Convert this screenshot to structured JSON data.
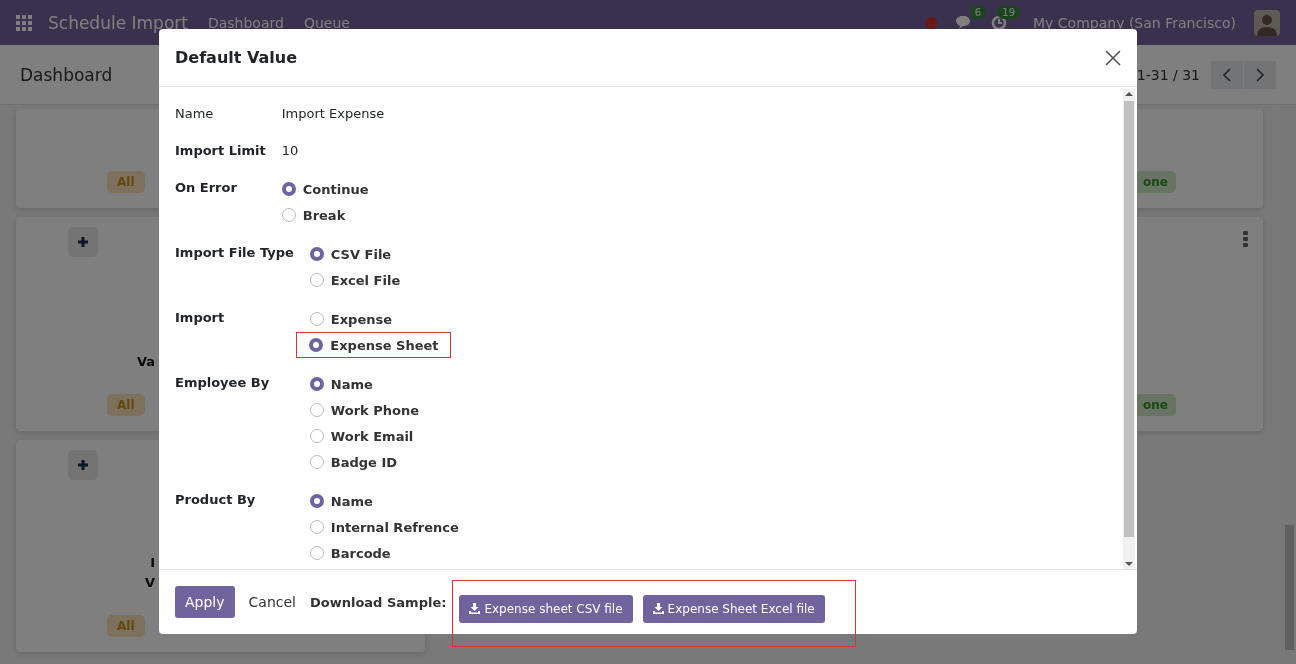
{
  "navbar": {
    "app_title": "Schedule Import",
    "menu": [
      {
        "label": "Dashboard"
      },
      {
        "label": "Queue"
      }
    ],
    "messages_count": "6",
    "activities_count": "19",
    "company": "My Company (San Francisco)"
  },
  "control_panel": {
    "title": "Dashboard",
    "pager": "1-31 / 31"
  },
  "cards": [
    {
      "left_badge": "All",
      "right_badge": "one"
    },
    {
      "title_lines": [
        "Va"
      ],
      "left_badge": "All",
      "right_badge": "one",
      "add": true,
      "kebab": true
    },
    {
      "title_lines": [
        "I",
        "V"
      ],
      "left_badge": "All",
      "add": true
    }
  ],
  "dialog": {
    "title": "Default Value",
    "groups": [
      {
        "fields": [
          {
            "kind": "text",
            "label": "Name",
            "value": "Import Expense",
            "bold_label": false
          },
          {
            "kind": "text",
            "label": "Import Limit",
            "value": "10",
            "bold_label": true
          },
          {
            "kind": "radio",
            "label": "On Error",
            "options": [
              {
                "label": "Continue",
                "selected": true,
                "highlighted": false
              },
              {
                "label": "Break",
                "selected": false,
                "highlighted": false
              }
            ]
          }
        ]
      },
      {
        "fields": [
          {
            "kind": "radio",
            "label": "Import File Type",
            "options": [
              {
                "label": "CSV File",
                "selected": true,
                "highlighted": false
              },
              {
                "label": "Excel File",
                "selected": false,
                "highlighted": false
              }
            ]
          },
          {
            "kind": "radio",
            "label": "Import",
            "options": [
              {
                "label": "Expense",
                "selected": false,
                "highlighted": false
              },
              {
                "label": "Expense Sheet",
                "selected": true,
                "highlighted": true
              }
            ]
          },
          {
            "kind": "radio",
            "label": "Employee By",
            "options": [
              {
                "label": "Name",
                "selected": true,
                "highlighted": false
              },
              {
                "label": "Work Phone",
                "selected": false,
                "highlighted": false
              },
              {
                "label": "Work Email",
                "selected": false,
                "highlighted": false
              },
              {
                "label": "Badge ID",
                "selected": false,
                "highlighted": false
              }
            ]
          },
          {
            "kind": "radio",
            "label": "Product By",
            "options": [
              {
                "label": "Name",
                "selected": true,
                "highlighted": false
              },
              {
                "label": "Internal Refrence",
                "selected": false,
                "highlighted": false
              },
              {
                "label": "Barcode",
                "selected": false,
                "highlighted": false
              }
            ]
          }
        ]
      }
    ],
    "footer": {
      "apply": "Apply",
      "cancel": "Cancel",
      "download_label": "Download Sample:",
      "downloads_highlighted": true,
      "downloads": [
        "Expense sheet CSV file",
        "Expense Sheet Excel file"
      ]
    }
  }
}
